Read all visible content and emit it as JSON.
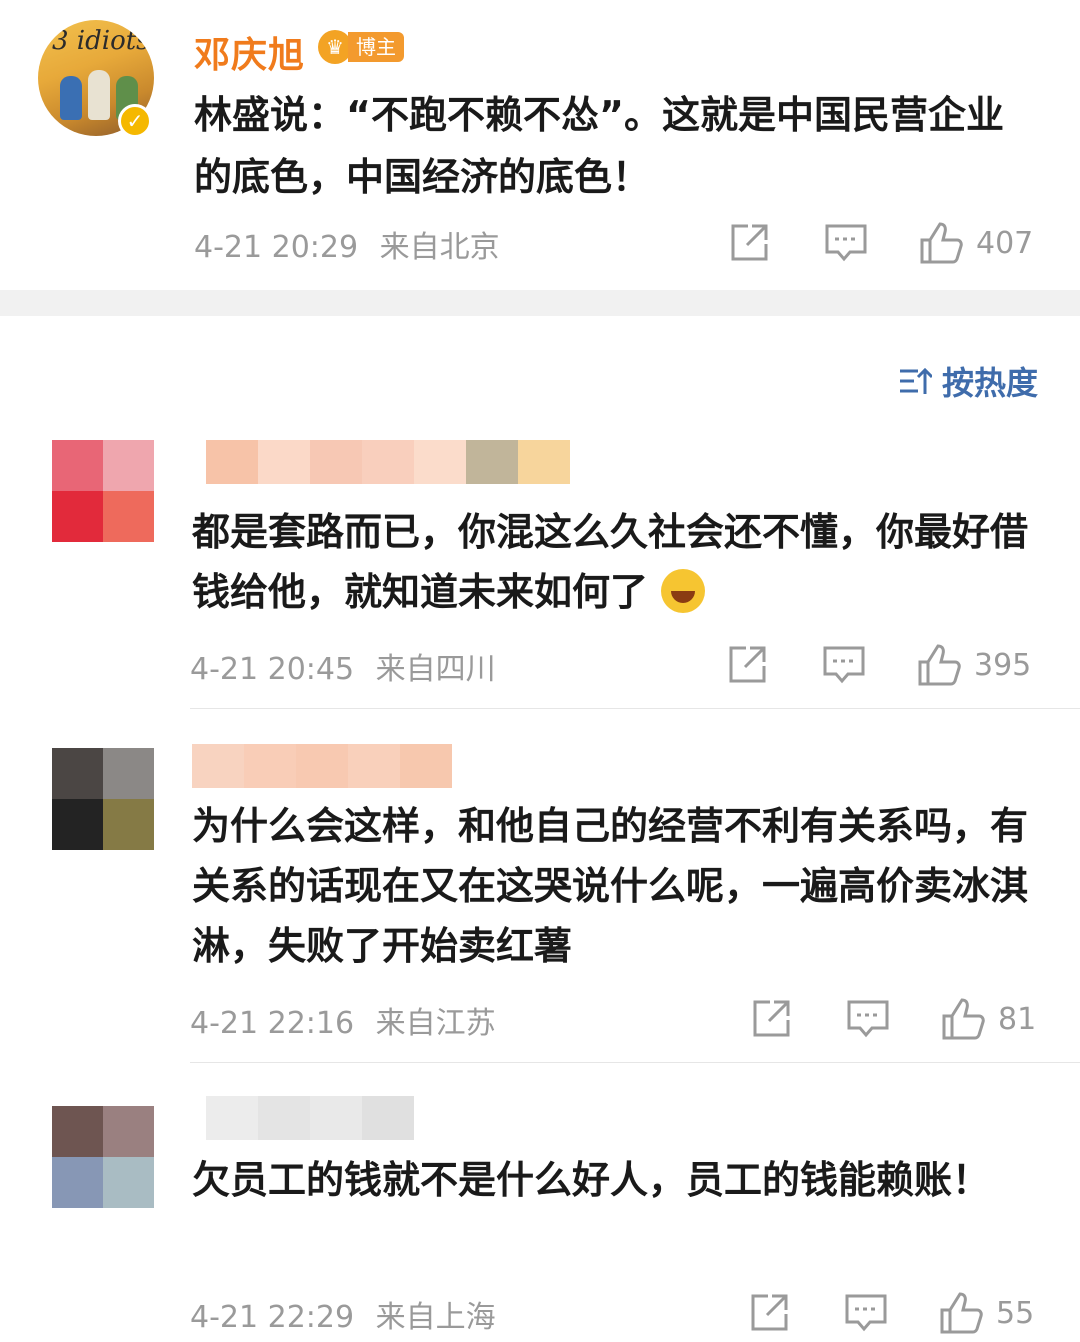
{
  "post": {
    "avatar_text": "3 idiots",
    "author": "邓庆旭",
    "badge": "博主",
    "text": "林盛说：“不跑不赖不怂”。这就是中国民营企业的底色，中国经济的底色！",
    "time": "4-21 20:29",
    "location": "来自北京",
    "likes": "407"
  },
  "sort": {
    "label": "按热度"
  },
  "comments": [
    {
      "text": "都是套路而已，你混这么久社会还不懂，你最好借钱给他，就知道未来如何了",
      "emoji": "laughing-tears-icon",
      "time": "4-21 20:45",
      "location": "来自四川",
      "likes": "395"
    },
    {
      "text": "为什么会这样，和他自己的经营不利有关系吗，有关系的话现在又在这哭说什么呢，一遍高价卖冰淇淋，失败了开始卖红薯",
      "time": "4-21 22:16",
      "location": "来自江苏",
      "likes": "81"
    },
    {
      "text": "欠员工的钱就不是什么好人，员工的钱能赖账！",
      "time": "4-21 22:29",
      "location": "来自上海",
      "likes": "55"
    }
  ],
  "colors": {
    "author": "#f07b1c",
    "sort": "#3f6cab",
    "meta": "#9a9a9a"
  }
}
